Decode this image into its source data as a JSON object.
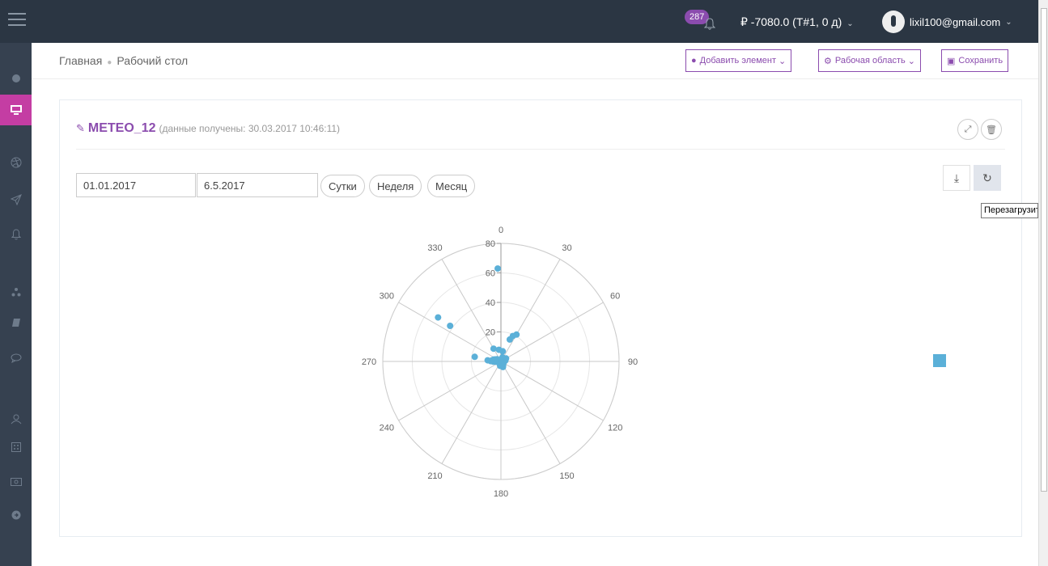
{
  "header": {
    "notifications_count": "287",
    "balance": "₽ -7080.0 (Т#1, 0 д)",
    "user_email": "lixil100@gmail.com"
  },
  "breadcrumb": {
    "home": "Главная",
    "current": "Рабочий стол"
  },
  "toolbar": {
    "add_label": "Добавить элемент",
    "workspace_label": "Рабочая область",
    "save_label": "Сохранить"
  },
  "widget": {
    "title": "METEO_12",
    "subtitle": "(данные получены: 30.03.2017 10:46:11)",
    "date_from": "01.01.2017",
    "date_to": "6.5.2017",
    "periods": [
      "Сутки",
      "Неделя",
      "Месяц"
    ],
    "tooltip": "Перезагрузить"
  },
  "chart_data": {
    "type": "scatter",
    "coordinate_system": "polar",
    "angle_ticks": [
      "0",
      "30",
      "60",
      "90",
      "120",
      "150",
      "180",
      "210",
      "240",
      "270",
      "300",
      "330"
    ],
    "radial_ticks": [
      "0",
      "20",
      "40",
      "60",
      "80"
    ],
    "rlim": [
      0,
      80
    ],
    "series_color": "#5bb0d8",
    "points": [
      {
        "angle": 358,
        "r": 63
      },
      {
        "angle": 305,
        "r": 52
      },
      {
        "angle": 305,
        "r": 42
      },
      {
        "angle": 280,
        "r": 18
      },
      {
        "angle": 275,
        "r": 9
      },
      {
        "angle": 272,
        "r": 7
      },
      {
        "angle": 278,
        "r": 6
      },
      {
        "angle": 268,
        "r": 5
      },
      {
        "angle": 285,
        "r": 5
      },
      {
        "angle": 290,
        "r": 4
      },
      {
        "angle": 265,
        "r": 3
      },
      {
        "angle": 300,
        "r": 3
      },
      {
        "angle": 260,
        "r": 2
      },
      {
        "angle": 330,
        "r": 10
      },
      {
        "angle": 350,
        "r": 8
      },
      {
        "angle": 10,
        "r": 7
      },
      {
        "angle": 60,
        "r": 4
      },
      {
        "angle": 80,
        "r": 3
      },
      {
        "angle": 20,
        "r": 3
      },
      {
        "angle": 40,
        "r": 2
      },
      {
        "angle": 150,
        "r": 3
      },
      {
        "angle": 160,
        "r": 4
      },
      {
        "angle": 190,
        "r": 3
      },
      {
        "angle": 200,
        "r": 2
      },
      {
        "angle": 120,
        "r": 2
      },
      {
        "angle": 22,
        "r": 16
      },
      {
        "angle": 25,
        "r": 19
      },
      {
        "angle": 30,
        "r": 21
      },
      {
        "angle": 100,
        "r": 1
      },
      {
        "angle": 0,
        "r": 1
      }
    ]
  }
}
